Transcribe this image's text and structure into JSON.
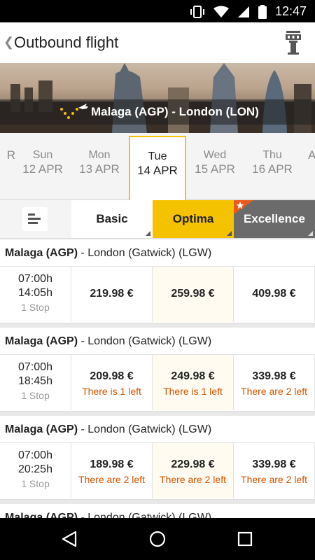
{
  "status": {
    "time": "12:47"
  },
  "header": {
    "title": "Outbound flight",
    "back_icon": "chevron-left-icon",
    "action_icon": "control-tower-icon"
  },
  "banner": {
    "route": "Malaga (AGP) - London (LON)"
  },
  "dates": [
    {
      "dow": "",
      "day": "R"
    },
    {
      "dow": "Sun",
      "day": "12 APR"
    },
    {
      "dow": "Mon",
      "day": "13 APR"
    },
    {
      "dow": "Tue",
      "day": "14 APR"
    },
    {
      "dow": "Wed",
      "day": "15 APR"
    },
    {
      "dow": "Thu",
      "day": "16 APR"
    },
    {
      "dow": "",
      "day": "A"
    }
  ],
  "fare_tabs": {
    "basic": "Basic",
    "optima": "Optima",
    "excellence": "Excellence"
  },
  "colors": {
    "accent": "#f5c200",
    "excellence": "#6b6b6b",
    "availability": "#d35400"
  },
  "flights": [
    {
      "origin": "Malaga (AGP)",
      "destination": " - London (Gatwick) (LGW)",
      "depart": "07:00h",
      "arrive": "14:05h",
      "stops": "1 Stop",
      "basic": {
        "price": "219.98 €",
        "avail": ""
      },
      "optima": {
        "price": "259.98 €",
        "avail": ""
      },
      "excellence": {
        "price": "409.98 €",
        "avail": ""
      }
    },
    {
      "origin": "Malaga (AGP)",
      "destination": " - London (Gatwick) (LGW)",
      "depart": "07:00h",
      "arrive": "18:45h",
      "stops": "1 Stop",
      "basic": {
        "price": "209.98 €",
        "avail": "There is 1 left"
      },
      "optima": {
        "price": "249.98 €",
        "avail": "There is 1 left"
      },
      "excellence": {
        "price": "339.98 €",
        "avail": "There are 2 left"
      }
    },
    {
      "origin": "Malaga (AGP)",
      "destination": " - London (Gatwick) (LGW)",
      "depart": "07:00h",
      "arrive": "20:25h",
      "stops": "1 Stop",
      "basic": {
        "price": "189.98 €",
        "avail": "There are 2 left"
      },
      "optima": {
        "price": "229.98 €",
        "avail": "There are 2 left"
      },
      "excellence": {
        "price": "339.98 €",
        "avail": "There are 2 left"
      }
    },
    {
      "origin": "Malaga (AGP)",
      "destination": " - London (Gatwick) (LGW)"
    }
  ]
}
